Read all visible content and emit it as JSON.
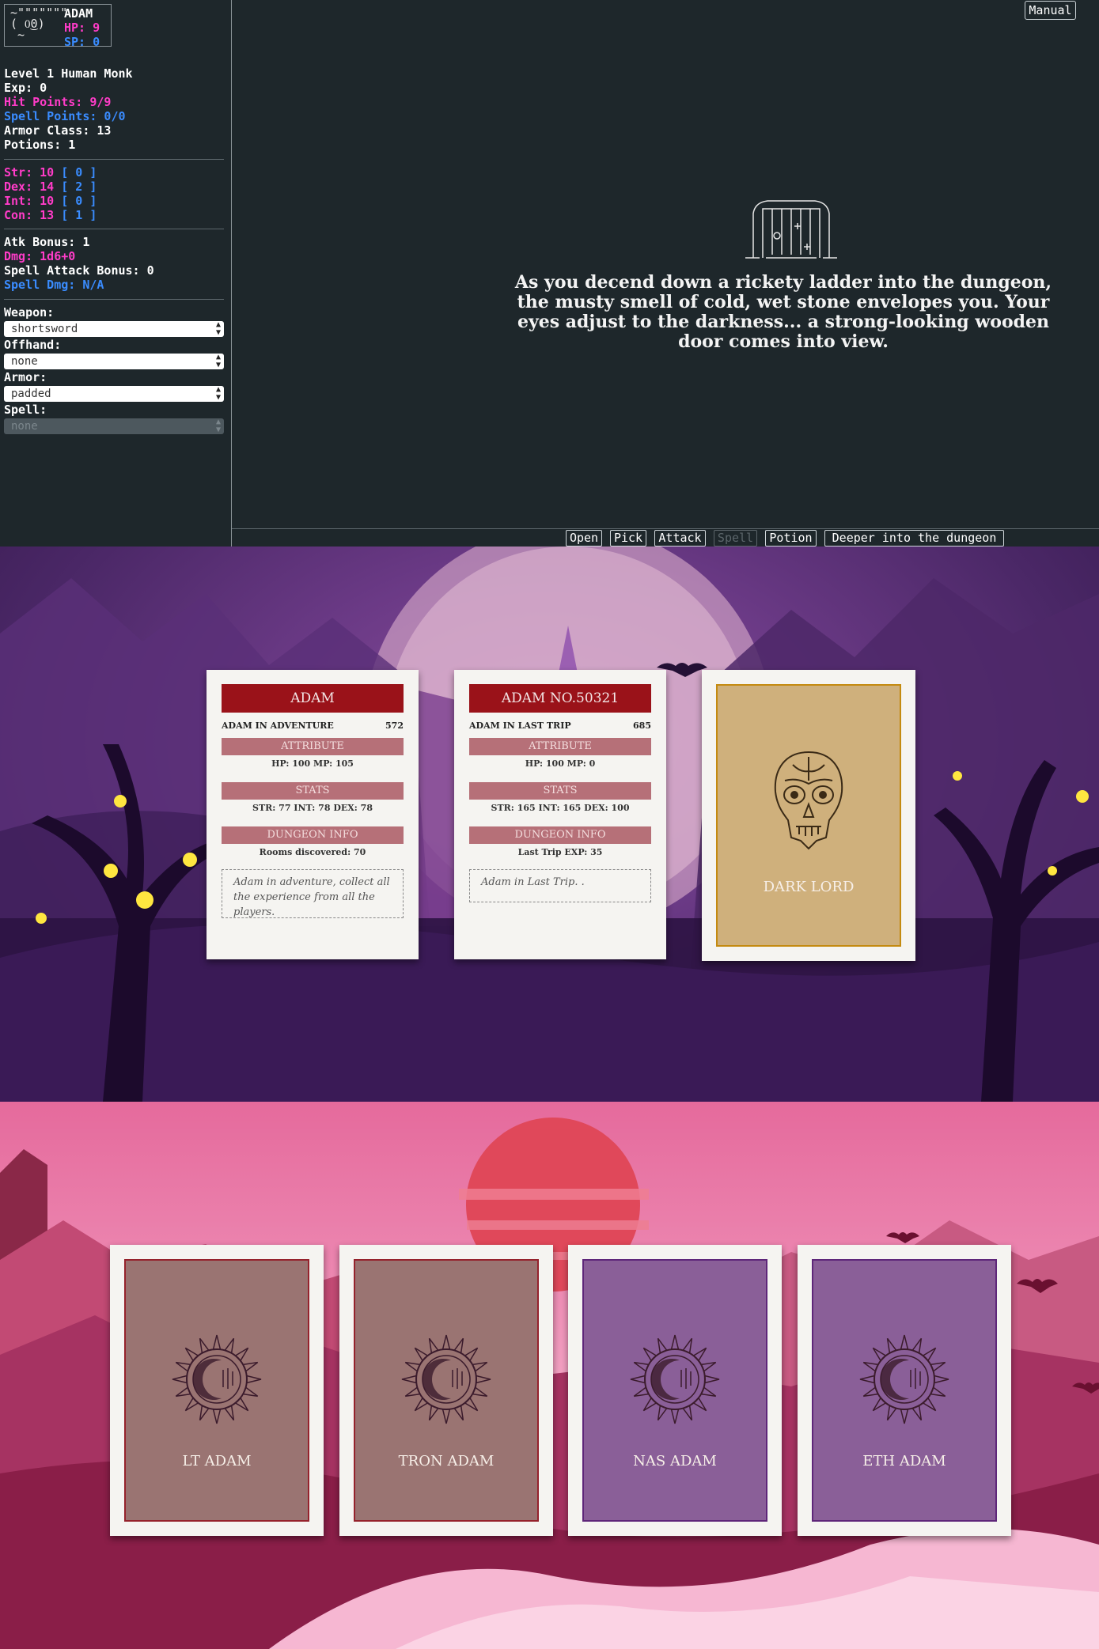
{
  "hud": {
    "portrait": "~\"\"\"\"\"\"\"\n( 0͜0)\n ~",
    "name": "ADAM",
    "hp": "HP: 9",
    "sp": "SP: 0"
  },
  "stats": {
    "class": "Level 1 Human Monk",
    "exp": "Exp: 0",
    "hit_points": "Hit Points: 9/9",
    "spell_points": "Spell Points: 0/0",
    "armor_class": "Armor Class: 13",
    "potions": "Potions: 1",
    "str_label": "Str: 10 ",
    "str_mod": "[ 0 ]",
    "dex_label": "Dex: 14 ",
    "dex_mod": "[ 2 ]",
    "int_label": "Int: 10 ",
    "int_mod": "[ 0 ]",
    "con_label": "Con: 13 ",
    "con_mod": "[ 1 ]",
    "atk_bonus": "Atk Bonus: 1",
    "dmg": "Dmg: 1d6+0",
    "spell_attack_bonus": "Spell Attack Bonus: 0",
    "spell_dmg": "Spell Dmg: N/A"
  },
  "equipment": {
    "weapon_label": "Weapon:",
    "weapon_value": "shortsword",
    "offhand_label": "Offhand:",
    "offhand_value": "none",
    "armor_label": "Armor:",
    "armor_value": "padded",
    "spell_label": "Spell:",
    "spell_value": "none"
  },
  "main": {
    "manual_button": "Manual",
    "narrative": "As you decend down a rickety ladder into the dungeon, the musty smell of cold, wet stone envelopes you. Your eyes adjust to the darkness... a strong-looking wooden door comes into view."
  },
  "actions": {
    "open": "Open",
    "pick": "Pick",
    "attack": "Attack",
    "spell": "Spell",
    "potion": "Potion",
    "deeper": "Deeper into the dungeon"
  },
  "profile_cards": [
    {
      "title": "ADAM",
      "subtitle": "ADAM IN ADVENTURE",
      "number": "572",
      "attribute_label": "ATTRIBUTE",
      "attribute_value": "HP: 100 MP: 105",
      "stats_label": "STATS",
      "stats_value": "STR: 77 INT: 78 DEX: 78",
      "dungeon_label": "DUNGEON INFO",
      "dungeon_value": "Rooms discovered: 70",
      "note": "Adam in adventure, collect all the experience from all the players."
    },
    {
      "title": "ADAM NO.50321",
      "subtitle": "ADAM IN LAST TRIP",
      "number": "685",
      "attribute_label": "ATTRIBUTE",
      "attribute_value": "HP: 100 MP: 0",
      "stats_label": "STATS",
      "stats_value": "STR: 165 INT: 165 DEX: 100",
      "dungeon_label": "DUNGEON INFO",
      "dungeon_value": "Last Trip EXP: 35",
      "note": "Adam in Last Trip. ."
    }
  ],
  "boss_card": {
    "name": "DARK LORD",
    "border_color": "#c48a10",
    "inner_color": "#cfb07c"
  },
  "token_cards": [
    {
      "name": "LT ADAM",
      "border_color": "#95222c",
      "inner_color": "#9a7472"
    },
    {
      "name": "TRON ADAM",
      "border_color": "#95222c",
      "inner_color": "#9a7472"
    },
    {
      "name": "NAS ADAM",
      "border_color": "#5e2679",
      "inner_color": "#8a5f98"
    },
    {
      "name": "ETH ADAM",
      "border_color": "#5e2679",
      "inner_color": "#8a5f98"
    }
  ]
}
